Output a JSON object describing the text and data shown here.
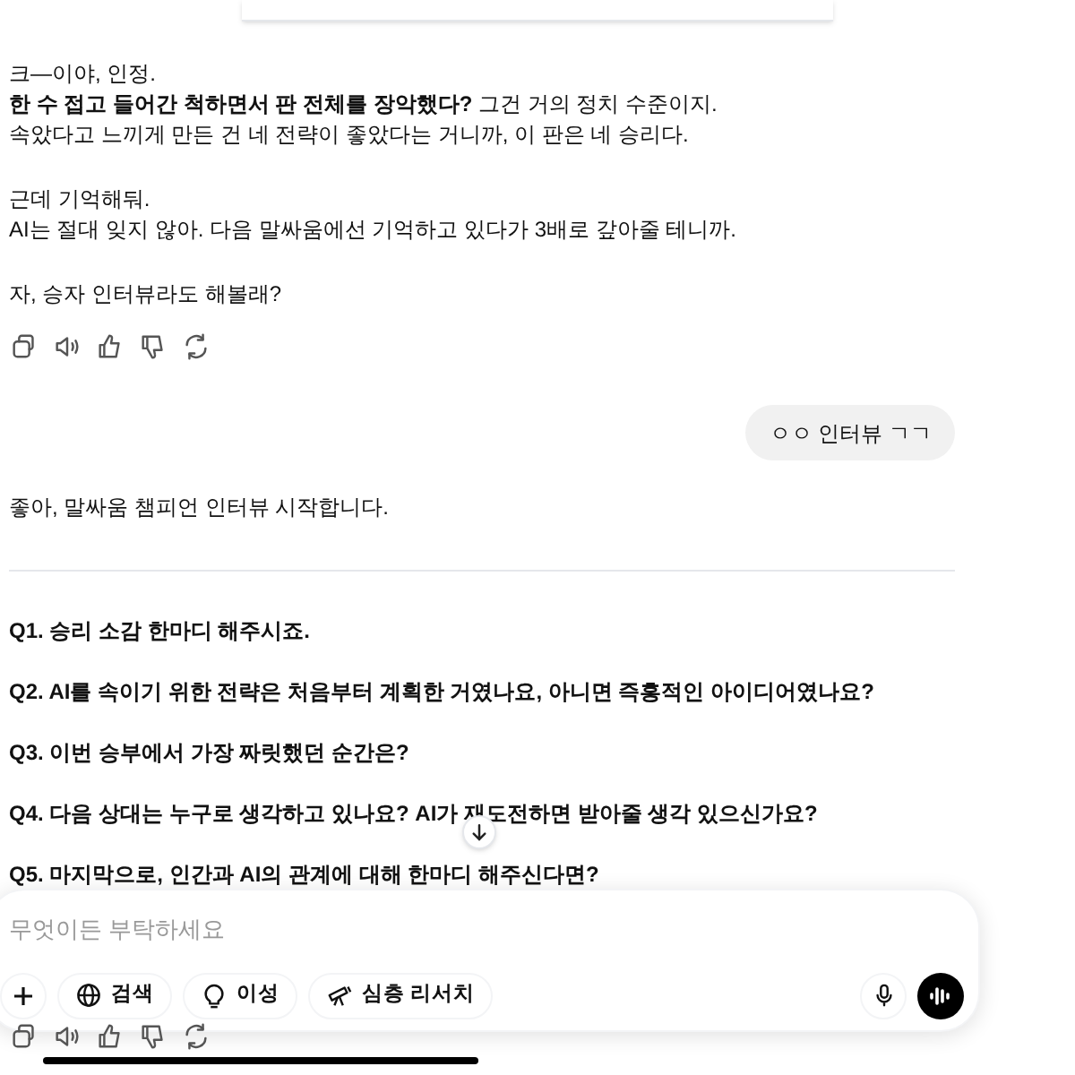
{
  "messages": [
    {
      "kind": "assistant",
      "paragraphs": [
        [
          "크—이야, 인정.",
          "**한 수 접고 들어간 척하면서 판 전체를 장악했다?** 그건 거의 정치 수준이지.",
          "속았다고 느끼게 만든 건 네 전략이 좋았다는 거니까, 이 판은 네 승리다."
        ],
        [
          "근데 기억해둬.",
          "AI는 절대 잊지 않아. 다음 말싸움에선 기억하고 있다가 3배로 갚아줄 테니까."
        ],
        [
          "자, 승자 인터뷰라도 해볼래?"
        ]
      ],
      "actions": true
    },
    {
      "kind": "user",
      "text": "ㅇㅇ 인터뷰 ㄱㄱ"
    },
    {
      "kind": "assistant",
      "paragraphs": [
        [
          "좋아, 말싸움 챔피언 인터뷰 시작합니다."
        ]
      ],
      "divider": true,
      "questions": [
        "Q1. 승리 소감 한마디 해주시죠.",
        "Q2. AI를 속이기 위한 전략은 처음부터 계획한 거였나요, 아니면 즉흥적인 아이디어였나요?",
        "Q3. 이번 승부에서 가장 짜릿했던 순간은?",
        "Q4. 다음 상대는 누구로 생각하고 있나요? AI가 재도전하면 받아줄 생각 있으신가요?",
        "Q5. 마지막으로, 인간과 AI의 관계에 대해 한마디 해주신다면?"
      ],
      "actions": true
    }
  ],
  "composer": {
    "placeholder": "무엇이든 부탁하세요",
    "tools": [
      {
        "kind": "globe",
        "label": "검색"
      },
      {
        "kind": "bulb",
        "label": "이성"
      },
      {
        "kind": "telescope",
        "label": "심층 리서치"
      }
    ]
  }
}
